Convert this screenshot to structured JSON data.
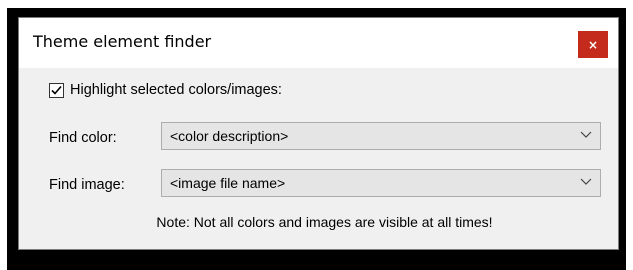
{
  "window": {
    "title": "Theme element finder",
    "close_label": "×"
  },
  "highlight": {
    "label": "Highlight selected colors/images:",
    "checked": true
  },
  "find_color": {
    "label": "Find color:",
    "value": "<color description>"
  },
  "find_image": {
    "label": "Find image:",
    "value": "<image file name>"
  },
  "note": "Note: Not all colors and images are visible at all times!",
  "colors": {
    "close_button": "#c42b1c",
    "dialog_bg": "#f0f0f0",
    "combo_bg": "#e5e5e5"
  },
  "icons": {
    "close": "close-icon",
    "checkmark": "checkmark-icon",
    "dropdown": "chevron-down-icon"
  }
}
